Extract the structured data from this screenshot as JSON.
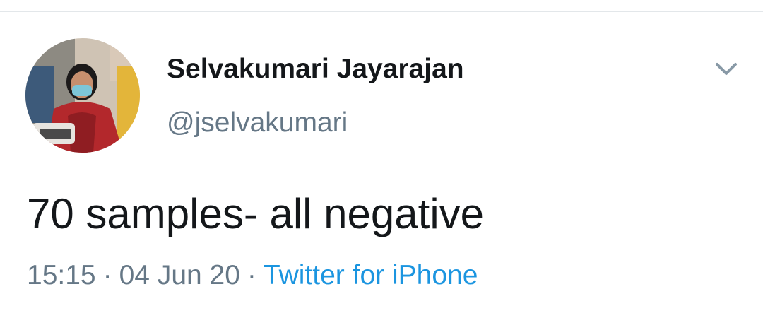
{
  "tweet": {
    "author": {
      "display_name": "Selvakumari Jayarajan",
      "handle": "@jselvakumari"
    },
    "text": "70 samples- all negative",
    "time": "15:15",
    "separator": "·",
    "date": "04 Jun 20",
    "source": "Twitter for iPhone"
  },
  "icons": {
    "menu": "chevron-down-icon",
    "avatar": "profile-photo"
  },
  "colors": {
    "text_primary": "#14171a",
    "text_secondary": "#657786",
    "link": "#1b95e0",
    "divider": "#e3e7ea"
  }
}
